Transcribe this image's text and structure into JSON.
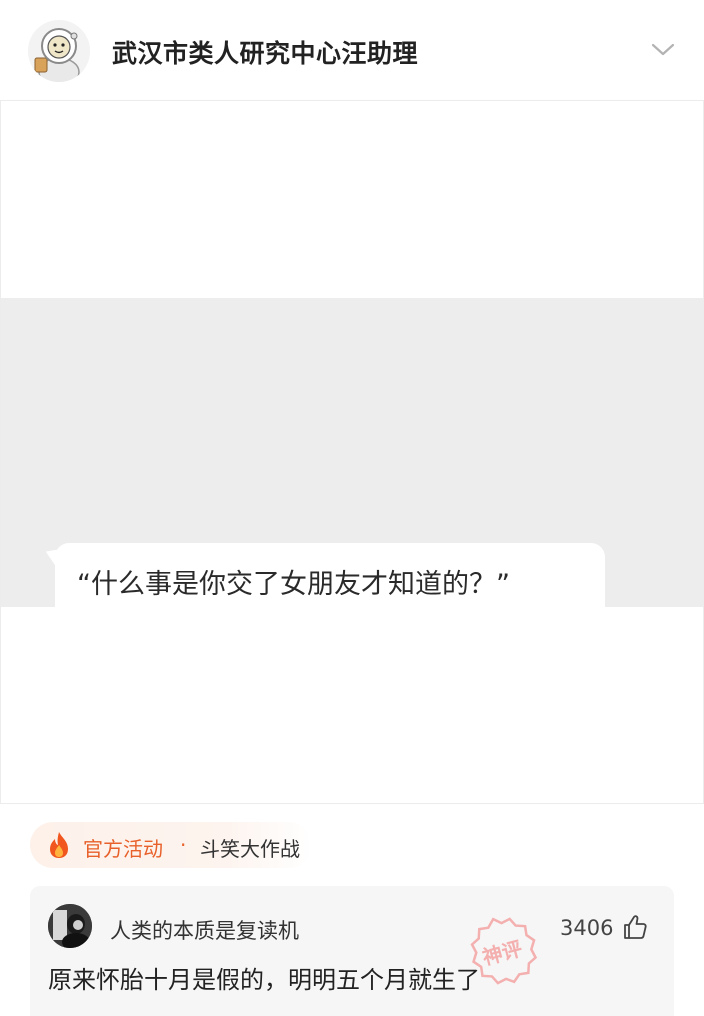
{
  "header": {
    "account_name": "武汉市类人研究中心汪助理",
    "avatar_icon": "astronaut-avatar-icon",
    "chevron_icon": "chevron-down-icon"
  },
  "post": {
    "bubble_text": "“什么事是你交了女朋友才知道的？”"
  },
  "activity": {
    "icon": "flame-icon",
    "label": "官方活动",
    "separator": "·",
    "name": "斗笑大作战",
    "accent_color": "#e8602a"
  },
  "top_comment": {
    "username": "人类的本质是复读机",
    "likes": "3406",
    "like_icon": "thumbs-up-icon",
    "badge_text": "神评",
    "badge_color": "#f4a8a8",
    "text": "原来怀胎十月是假的，明明五个月就生了"
  }
}
